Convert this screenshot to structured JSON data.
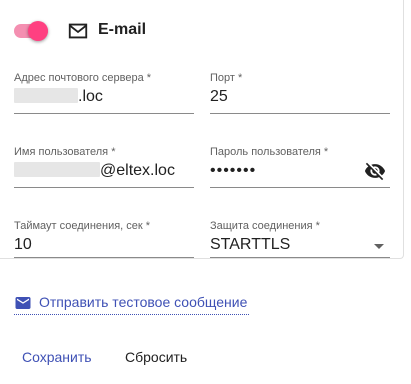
{
  "header": {
    "title": "E-mail",
    "enabled": true,
    "toggle_color": "#ff4081"
  },
  "fields": {
    "server": {
      "label": "Адрес почтового сервера *",
      "value_suffix": ".loc"
    },
    "port": {
      "label": "Порт *",
      "value": "25"
    },
    "username": {
      "label": "Имя пользователя *",
      "value_suffix": "@eltex.loc"
    },
    "password": {
      "label": "Пароль пользователя *",
      "value": "•••••••"
    },
    "timeout": {
      "label": "Таймаут соединения, сек *",
      "value": "10"
    },
    "security": {
      "label": "Защита соединения *",
      "value": "STARTTLS"
    }
  },
  "test_link": {
    "label": "Отправить тестовое сообщение"
  },
  "actions": {
    "save_label": "Сохранить",
    "reset_label": "Сбросить"
  },
  "colors": {
    "accent": "#3f51b5",
    "toggle": "#ff4081"
  }
}
